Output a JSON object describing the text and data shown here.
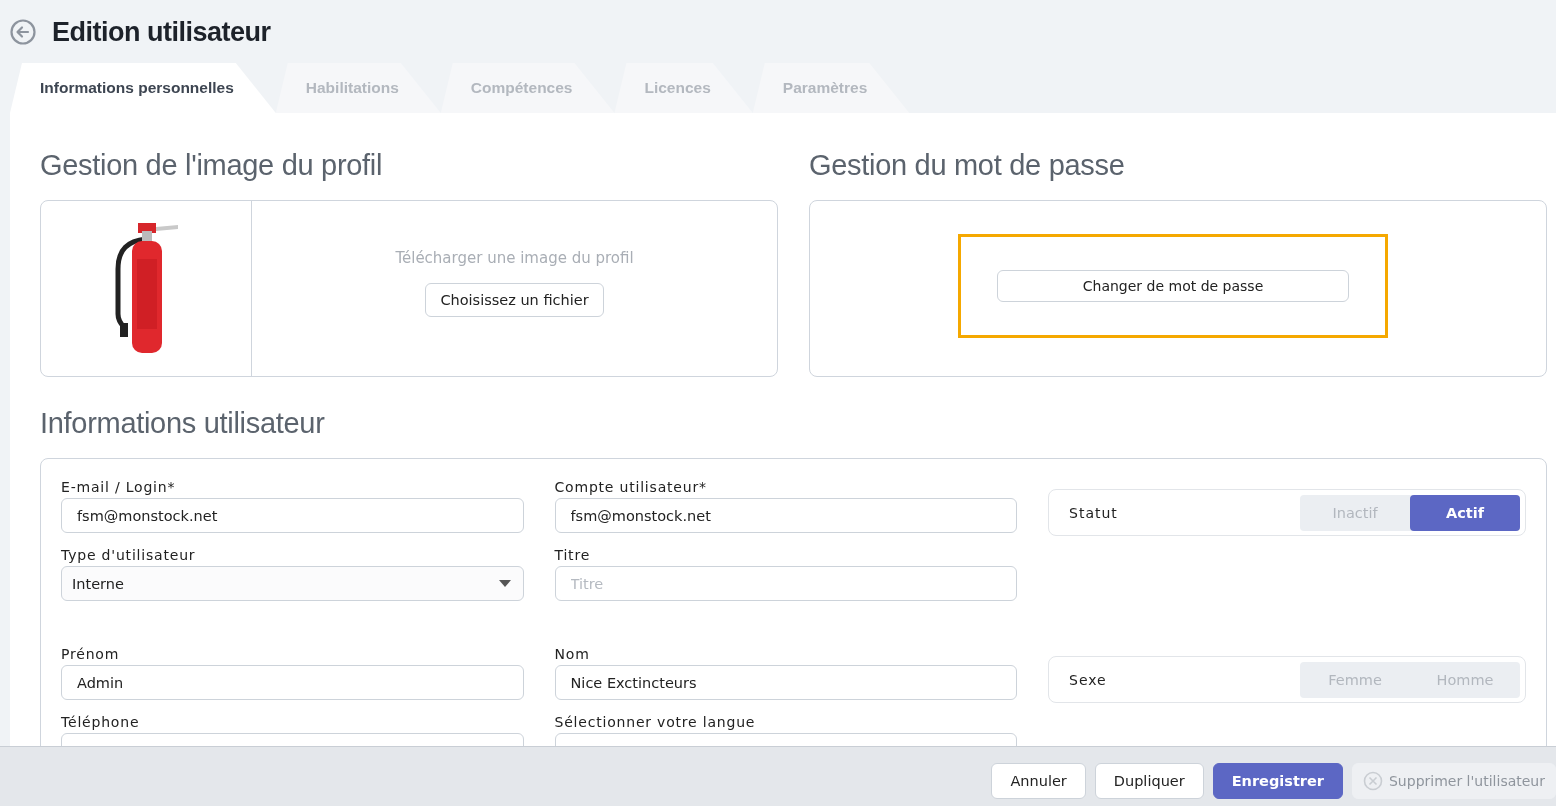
{
  "page": {
    "title": "Edition utilisateur"
  },
  "tabs": [
    {
      "label": "Informations personnelles",
      "selected": true
    },
    {
      "label": "Habilitations",
      "selected": false
    },
    {
      "label": "Compétences",
      "selected": false
    },
    {
      "label": "Licences",
      "selected": false
    },
    {
      "label": "Paramètres",
      "selected": false
    }
  ],
  "profile_image": {
    "heading": "Gestion de l'image du profil",
    "upload_hint": "Télécharger une image du profil",
    "button": "Choisissez un fichier"
  },
  "password": {
    "heading": "Gestion du mot de passe",
    "button": "Changer de mot de passe",
    "highlighted": true
  },
  "user_info": {
    "heading": "Informations utilisateur",
    "groups": [
      {
        "fields": [
          {
            "label": "E-mail / Login*",
            "value": "fsm@monstock.net",
            "kind": "text"
          },
          {
            "label": "Compte utilisateur*",
            "value": "fsm@monstock.net",
            "kind": "text"
          },
          {
            "label": "Type d'utilisateur",
            "value": "Interne",
            "kind": "select"
          },
          {
            "label": "Titre",
            "placeholder": "Titre",
            "kind": "text"
          }
        ],
        "toggle": {
          "label": "Statut",
          "options": [
            {
              "label": "Inactif",
              "selected": false
            },
            {
              "label": "Actif",
              "selected": true
            }
          ]
        }
      },
      {
        "fields": [
          {
            "label": "Prénom",
            "value": "Admin",
            "kind": "text"
          },
          {
            "label": "Nom",
            "value": "Nice Exctincteurs",
            "kind": "text"
          },
          {
            "label": "Téléphone",
            "kind": "text"
          },
          {
            "label": "Sélectionner votre langue",
            "kind": "language"
          }
        ],
        "toggle": {
          "label": "Sexe",
          "options": [
            {
              "label": "Femme",
              "selected": false
            },
            {
              "label": "Homme",
              "selected": false
            }
          ]
        }
      }
    ]
  },
  "footer": {
    "buttons": [
      {
        "label": "Annuler",
        "kind": "default"
      },
      {
        "label": "Dupliquer",
        "kind": "default"
      },
      {
        "label": "Enregistrer",
        "kind": "primary"
      },
      {
        "label": "Supprimer l'utilisateur",
        "kind": "disabled"
      }
    ]
  }
}
